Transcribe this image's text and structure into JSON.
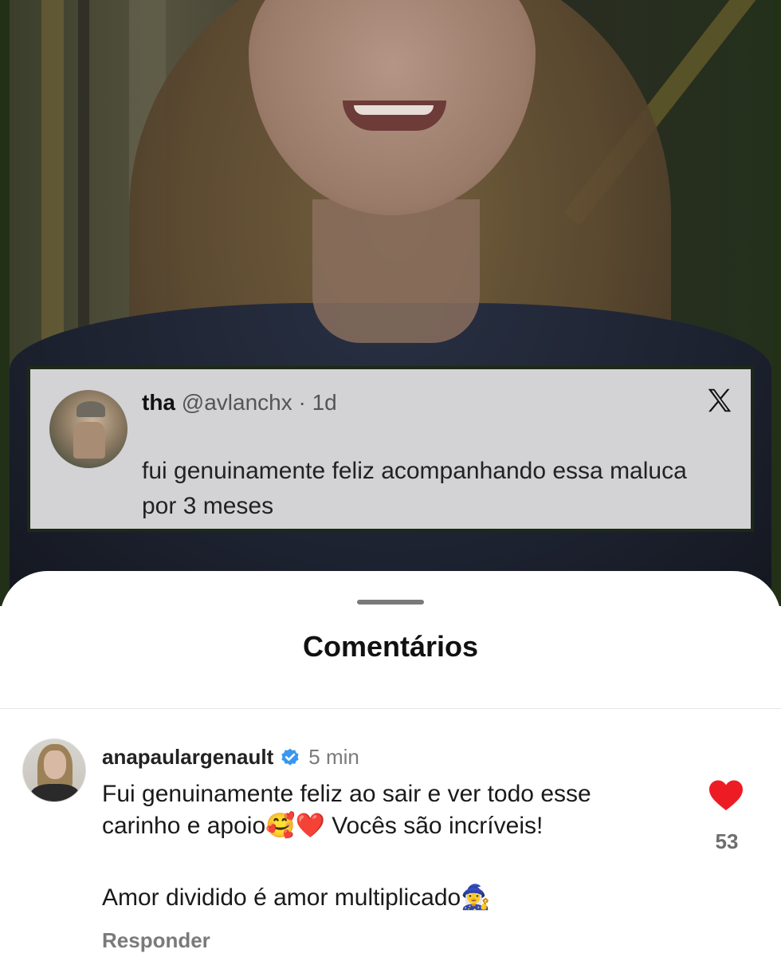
{
  "tweet": {
    "name": "tha",
    "handle": "@avlanchx",
    "separator": " · ",
    "age": "1d",
    "text": "fui genuinamente feliz acompanhando essa maluca por 3 meses",
    "platform_icon": "x-logo-icon"
  },
  "sheet": {
    "title": "Comentários"
  },
  "comment": {
    "username": "anapaulargenault",
    "time": "5 min",
    "text": "Fui genuinamente feliz ao sair e ver todo esse carinho e apoio🥰❤️ Vocês são incríveis!",
    "text2": "Amor dividido é amor multiplicado🧙‍♀️",
    "reply_label": "Responder",
    "likes": "53",
    "verified_color": "#3897f0",
    "like_color": "#ed1c24"
  }
}
